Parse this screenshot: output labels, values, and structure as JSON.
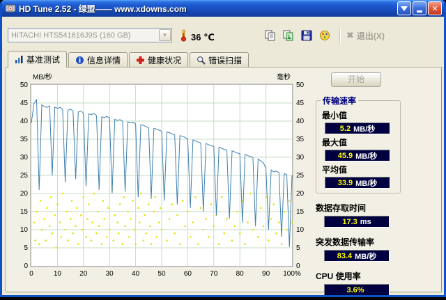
{
  "window": {
    "title": "HD Tune 2.52 - 绿盟—— www.xdowns.com"
  },
  "toolbar": {
    "drive_select": "HITACHI HTS541616J9S (160 GB)",
    "temperature": "36 ℃",
    "exit_label": "退出(X)"
  },
  "tabs": [
    {
      "label": "基准测试"
    },
    {
      "label": "信息详情"
    },
    {
      "label": "健康状况"
    },
    {
      "label": "错误扫描"
    }
  ],
  "panel": {
    "start_label": "开始",
    "group_title": "传输速率",
    "stats": [
      {
        "label": "最小值",
        "value": "5.2",
        "unit": "MB/秒"
      },
      {
        "label": "最大值",
        "value": "45.9",
        "unit": "MB/秒"
      },
      {
        "label": "平均值",
        "value": "33.9",
        "unit": "MB/秒"
      }
    ],
    "extras": [
      {
        "label": "数据存取时间",
        "value": "17.3",
        "unit": "ms"
      },
      {
        "label": "突发数据传输率",
        "value": "83.4",
        "unit": "MB/秒"
      },
      {
        "label": "CPU 使用率",
        "value": "3.6%",
        "unit": ""
      }
    ]
  },
  "chart_data": {
    "type": "line+scatter",
    "left_axis_label": "MB/秒",
    "right_axis_label": "毫秒",
    "xlim": [
      0,
      100
    ],
    "ylim": [
      0,
      50
    ],
    "grid_on": true,
    "grid_color": "#C6DCC6",
    "y_ticks": [
      50,
      45,
      40,
      35,
      30,
      25,
      20,
      15,
      10,
      5,
      0
    ],
    "x_ticks": [
      0,
      10,
      20,
      30,
      40,
      50,
      60,
      70,
      80,
      90,
      100
    ],
    "x_tick_labels": [
      "0",
      "10",
      "20",
      "30",
      "40",
      "50",
      "60",
      "70",
      "80",
      "90",
      "100%"
    ],
    "transfer_rate_series": {
      "name": "传输速率",
      "color": "#3E7FB0",
      "x_step": 1,
      "values": [
        39.5,
        44.8,
        45.9,
        21,
        44.5,
        44,
        43.8,
        44.2,
        25,
        43.9,
        43.5,
        43.8,
        43.2,
        23,
        43,
        43.3,
        42.8,
        24,
        42.5,
        42.8,
        42.2,
        22,
        42,
        41.8,
        42.1,
        41.5,
        21,
        41.2,
        41,
        41.3,
        40.8,
        20,
        40.5,
        40.2,
        40.4,
        40,
        20.5,
        39.8,
        39.5,
        39.7,
        39.2,
        19,
        39,
        38.8,
        38.5,
        38.2,
        18.5,
        38,
        37.8,
        37.5,
        37.2,
        18,
        37,
        36.8,
        36.5,
        36.2,
        17,
        36,
        35.8,
        35.5,
        35,
        16,
        34.8,
        34.5,
        34.2,
        34,
        15,
        33.8,
        33.5,
        33.2,
        33,
        14,
        32.8,
        32.5,
        32.2,
        32,
        13,
        31.8,
        31.5,
        31.2,
        31,
        12,
        30.8,
        30.5,
        30.2,
        30,
        11,
        29.5,
        29,
        28.5,
        27,
        10,
        26.5,
        26,
        26.2,
        25.8,
        8,
        25.5,
        25.2,
        5.2,
        25
      ]
    },
    "access_time_points": {
      "name": "存取时间",
      "color": "#E3E300",
      "points": [
        [
          1,
          12
        ],
        [
          1.5,
          7
        ],
        [
          2,
          15
        ],
        [
          3,
          6
        ],
        [
          3.5,
          18
        ],
        [
          4,
          10
        ],
        [
          5,
          13
        ],
        [
          5.5,
          7
        ],
        [
          6,
          16
        ],
        [
          7,
          11
        ],
        [
          7.5,
          19
        ],
        [
          8,
          9
        ],
        [
          9,
          14
        ],
        [
          9.5,
          5
        ],
        [
          10,
          17
        ],
        [
          11,
          12
        ],
        [
          11.5,
          8
        ],
        [
          12,
          20
        ],
        [
          13,
          10
        ],
        [
          13.5,
          15
        ],
        [
          14,
          7
        ],
        [
          15,
          13
        ],
        [
          15.5,
          18
        ],
        [
          16,
          9
        ],
        [
          17,
          11
        ],
        [
          17.5,
          16
        ],
        [
          18,
          6
        ],
        [
          19,
          14
        ],
        [
          19.5,
          10
        ],
        [
          20,
          19
        ],
        [
          21,
          8
        ],
        [
          21.5,
          13
        ],
        [
          22,
          17
        ],
        [
          23,
          7
        ],
        [
          23.5,
          12
        ],
        [
          24,
          20
        ],
        [
          25,
          9
        ],
        [
          25.5,
          15
        ],
        [
          26,
          11
        ],
        [
          27,
          6
        ],
        [
          27.5,
          18
        ],
        [
          28,
          13
        ],
        [
          29,
          8
        ],
        [
          29.5,
          16
        ],
        [
          30,
          10
        ],
        [
          31,
          21
        ],
        [
          31.5,
          7
        ],
        [
          32,
          14
        ],
        [
          33,
          12
        ],
        [
          33.5,
          9
        ],
        [
          34,
          17
        ],
        [
          35,
          6
        ],
        [
          35.5,
          19
        ],
        [
          36,
          11
        ],
        [
          37,
          15
        ],
        [
          37.5,
          8
        ],
        [
          38,
          13
        ],
        [
          39,
          18
        ],
        [
          39.5,
          10
        ],
        [
          40,
          6
        ],
        [
          41,
          16
        ],
        [
          41.5,
          12
        ],
        [
          42,
          20
        ],
        [
          43,
          7
        ],
        [
          43.5,
          14
        ],
        [
          44,
          9
        ],
        [
          45,
          17
        ],
        [
          45.5,
          11
        ],
        [
          46,
          6
        ],
        [
          47,
          15
        ],
        [
          47.5,
          19
        ],
        [
          48,
          8
        ],
        [
          49,
          12
        ],
        [
          49.5,
          16
        ],
        [
          50,
          10
        ],
        [
          51,
          21
        ],
        [
          52,
          7
        ],
        [
          53,
          13
        ],
        [
          54,
          17
        ],
        [
          55,
          9
        ],
        [
          56,
          14
        ],
        [
          57,
          6
        ],
        [
          58,
          18
        ],
        [
          59,
          11
        ],
        [
          60,
          15
        ],
        [
          61,
          8
        ],
        [
          62,
          12
        ],
        [
          63,
          19
        ],
        [
          64,
          6
        ],
        [
          65,
          16
        ],
        [
          66,
          10
        ],
        [
          67,
          13
        ],
        [
          68,
          8
        ],
        [
          69,
          17
        ],
        [
          70,
          11
        ],
        [
          71,
          14
        ],
        [
          72,
          6
        ],
        [
          73,
          19
        ],
        [
          74,
          9
        ],
        [
          75,
          13
        ],
        [
          76,
          16
        ],
        [
          77,
          7
        ],
        [
          78,
          11
        ],
        [
          79,
          15
        ],
        [
          80,
          9
        ],
        [
          81,
          18
        ],
        [
          82,
          6
        ],
        [
          83,
          12
        ],
        [
          84,
          20
        ],
        [
          85,
          10
        ],
        [
          86,
          14
        ],
        [
          87,
          8
        ],
        [
          88,
          16
        ],
        [
          89,
          11
        ],
        [
          90,
          19
        ],
        [
          91,
          7
        ],
        [
          92,
          13
        ],
        [
          93,
          17
        ],
        [
          94,
          9
        ],
        [
          95,
          12
        ],
        [
          96,
          6
        ],
        [
          97,
          15
        ],
        [
          98,
          10
        ],
        [
          99,
          18
        ],
        [
          100,
          12
        ]
      ]
    }
  },
  "colors": {
    "value_box_bg": "#000040",
    "value_color": "#FFFF00",
    "unit_color": "#FFFFFF",
    "titlebar_blue": "#1E5BD0",
    "dialog_bg": "#ECE9D8"
  }
}
